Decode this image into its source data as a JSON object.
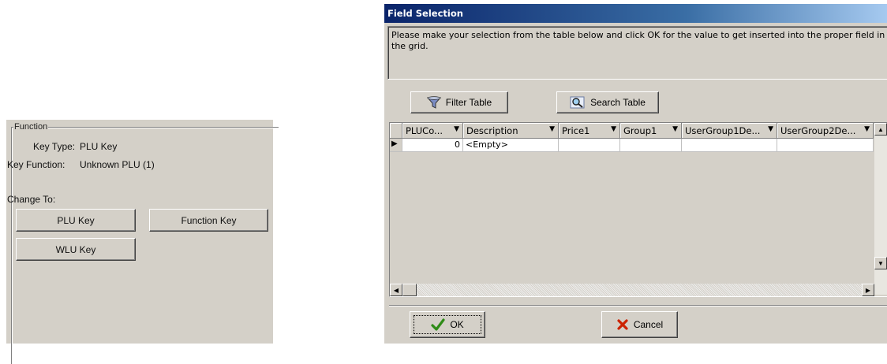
{
  "left_panel": {
    "group_title": "Function",
    "key_type_label": "Key Type:",
    "key_type_value": "PLU Key",
    "key_function_label": "Key Function:",
    "key_function_value": "Unknown PLU (1)",
    "change_to_label": "Change To:",
    "buttons": {
      "plu": "PLU Key",
      "function": "Function Key",
      "wlu": "WLU Key"
    }
  },
  "dialog": {
    "title": "Field Selection",
    "message": "Please make your selection from the table below and click OK for the value to get inserted into the proper field in the grid.",
    "filter_button": "Filter Table",
    "search_button": "Search Table",
    "columns": [
      "PLUCo...",
      "Description",
      "Price1",
      "Group1",
      "UserGroup1De...",
      "UserGroup2De..."
    ],
    "rows": [
      {
        "plucode": "0",
        "description": "<Empty>",
        "price1": "",
        "group1": "",
        "ug1": "",
        "ug2": ""
      }
    ],
    "ok_button": "OK",
    "cancel_button": "Cancel",
    "icons": {
      "filter": "funnel-icon",
      "search": "magnifier-icon",
      "ok": "checkmark-icon",
      "cancel": "x-icon"
    },
    "colors": {
      "ok_icon": "#2e8b17",
      "cancel_icon": "#cc2200",
      "title_start": "#0a246a"
    }
  }
}
